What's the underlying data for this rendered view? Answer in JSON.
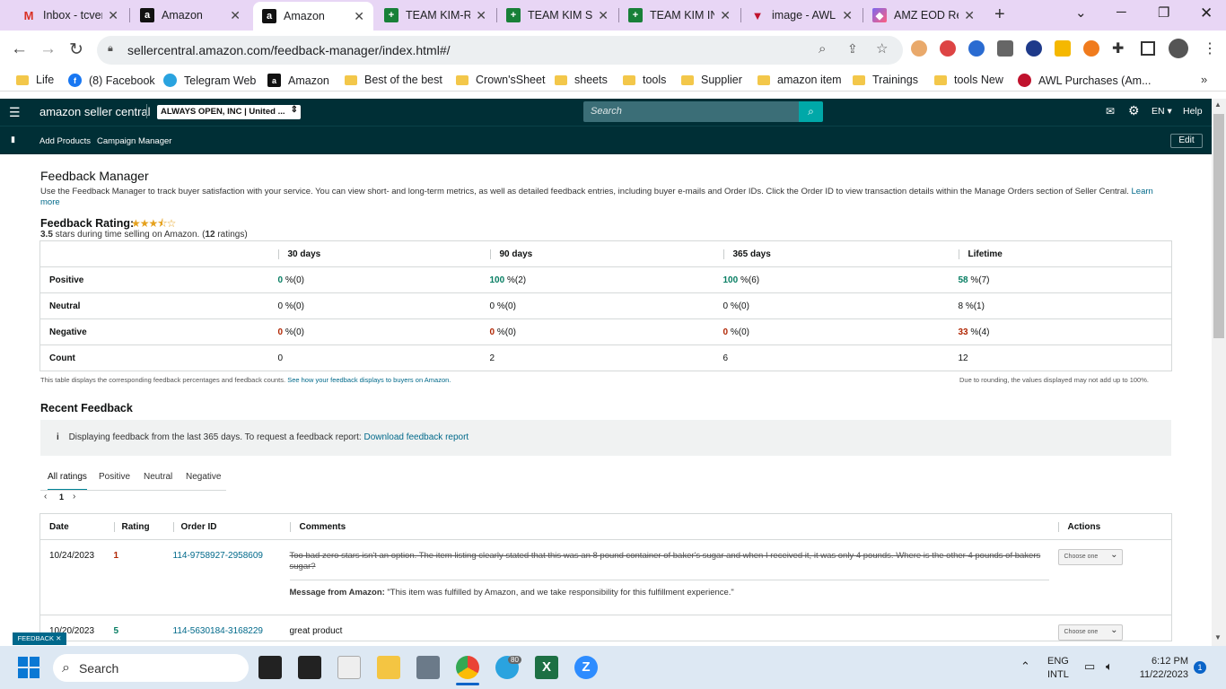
{
  "browser": {
    "tabs": [
      {
        "title": "Inbox - tcver",
        "icon": "gmail-icon",
        "active": false
      },
      {
        "title": "Amazon",
        "icon": "amazon-icon",
        "active": false
      },
      {
        "title": "Amazon",
        "icon": "amazon-icon",
        "active": true
      },
      {
        "title": "TEAM KIM-R",
        "icon": "sheets-icon",
        "active": false
      },
      {
        "title": "TEAM KIM S",
        "icon": "sheets-icon",
        "active": false
      },
      {
        "title": "TEAM KIM IN",
        "icon": "sheets-icon",
        "active": false
      },
      {
        "title": "image - AWL",
        "icon": "awl-icon",
        "active": false
      },
      {
        "title": "AMZ EOD Re",
        "icon": "clickup-icon",
        "active": false
      }
    ],
    "url": "sellercentral.amazon.com/feedback-manager/index.html#/",
    "bookmarks": [
      {
        "label": "Life",
        "type": "folder"
      },
      {
        "label": "(8) Facebook",
        "type": "facebook"
      },
      {
        "label": "Telegram Web",
        "type": "telegram"
      },
      {
        "label": "Amazon",
        "type": "amazon"
      },
      {
        "label": "Best of the best",
        "type": "folder"
      },
      {
        "label": "Crown'sSheet",
        "type": "folder"
      },
      {
        "label": "sheets",
        "type": "folder"
      },
      {
        "label": "tools",
        "type": "folder"
      },
      {
        "label": "Supplier",
        "type": "folder"
      },
      {
        "label": "amazon item",
        "type": "folder"
      },
      {
        "label": "Trainings",
        "type": "folder"
      },
      {
        "label": "tools New",
        "type": "folder"
      },
      {
        "label": "AWL Purchases (Am...",
        "type": "awl"
      }
    ]
  },
  "header": {
    "logo": "amazon seller central",
    "account": "ALWAYS OPEN, INC | United ...",
    "search_placeholder": "Search",
    "lang": "EN",
    "help": "Help",
    "nav": [
      "Add Products",
      "Campaign Manager"
    ],
    "edit": "Edit"
  },
  "page": {
    "title": "Feedback Manager",
    "description": "Use the Feedback Manager to track buyer satisfaction with your service. You can view short- and long-term metrics, as well as detailed feedback entries, including buyer e-mails and Order IDs. Click the Order ID to view transaction details within the Manage Orders section of Seller Central.",
    "learn_more": "Learn more",
    "rating_label": "Feedback Rating:",
    "rating_value": 3.5,
    "rating_stars": "★★★⯪☆",
    "summary_stars": "3.5",
    "summary_mid": " stars during time selling on Amazon. (",
    "summary_count": "12",
    "summary_end": " ratings)"
  },
  "metrics": {
    "columns": [
      "30 days",
      "90 days",
      "365 days",
      "Lifetime"
    ],
    "rows": [
      {
        "label": "Positive",
        "cells": [
          [
            "0",
            " %(0)"
          ],
          [
            "100",
            " %(2)"
          ],
          [
            "100",
            " %(6)"
          ],
          [
            "58",
            " %(7)"
          ]
        ]
      },
      {
        "label": "Neutral",
        "cells": [
          [
            "0 %(0)"
          ],
          [
            "0 %(0)"
          ],
          [
            "0 %(0)"
          ],
          [
            "8 %(1)"
          ]
        ]
      },
      {
        "label": "Negative",
        "cells": [
          [
            "0",
            " %(0)"
          ],
          [
            "0",
            " %(0)"
          ],
          [
            "0",
            " %(0)"
          ],
          [
            "33",
            " %(4)"
          ]
        ]
      },
      {
        "label": "Count",
        "cells": [
          [
            "0"
          ],
          [
            "2"
          ],
          [
            "6"
          ],
          [
            "12"
          ]
        ]
      }
    ],
    "footnote_left": "This table displays the corresponding feedback percentages and feedback counts.",
    "footnote_link": "See how your feedback displays to buyers on Amazon.",
    "footnote_right": "Due to rounding, the values displayed may not add up to 100%."
  },
  "recent": {
    "title": "Recent Feedback",
    "info_text": "Displaying feedback from the last 365 days. To request a feedback report:",
    "info_link": "Download feedback report",
    "filters": [
      "All ratings",
      "Positive",
      "Neutral",
      "Negative"
    ],
    "page": "1",
    "columns": [
      "Date",
      "Rating",
      "Order ID",
      "Comments",
      "Actions"
    ],
    "rows": [
      {
        "date": "10/24/2023",
        "rating": "1",
        "order_id": "114-9758927-2958609",
        "comment": "Too bad zero stars isn't an option. The item listing clearly stated that this was an 8 pound container of baker's sugar and when I received it, it was only 4 pounds. Where is the other 4 pounds of bakers sugar?",
        "msg_label": "Message from Amazon:",
        "msg_text": " \"This item was fulfilled by Amazon, and we take responsibility for this fulfillment experience.\"",
        "action": "Choose one"
      },
      {
        "date": "10/20/2023",
        "rating": "5",
        "order_id": "114-5630184-3168229",
        "comment": "great product",
        "action": "Choose one"
      }
    ],
    "feedback_tag": "FEEDBACK ✕"
  },
  "taskbar": {
    "search": "Search",
    "lang1": "ENG",
    "lang2": "INTL",
    "time": "6:12 PM",
    "date": "11/22/2023",
    "notif": "1",
    "telegram_badge": "80"
  }
}
